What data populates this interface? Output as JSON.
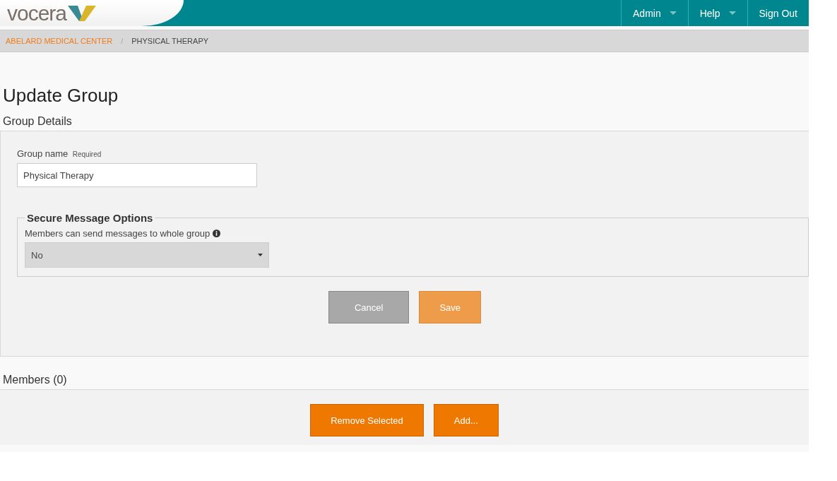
{
  "header": {
    "logo": "vocera",
    "menu": [
      {
        "label": "Admin",
        "dropdown": true
      },
      {
        "label": "Help",
        "dropdown": true
      },
      {
        "label": "Sign Out",
        "dropdown": false
      }
    ]
  },
  "breadcrumb": [
    "ABELARD MEDICAL CENTER",
    "PHYSICAL THERAPY"
  ],
  "breadcrumb_separator": "/",
  "title": "Update Group",
  "group_details": {
    "heading": "Group Details",
    "name_label": "Group name",
    "required": "Required",
    "name_value": "Physical Therapy",
    "fieldset": {
      "legend": "Secure Message Options",
      "label": "Members can send messages to whole group",
      "value": "No"
    },
    "buttons": [
      {
        "label": "Cancel",
        "kind": "secondary",
        "disabled": false
      },
      {
        "label": "Save",
        "kind": "primary",
        "disabled": true
      }
    ]
  },
  "members": {
    "heading": "Members (0)",
    "buttons": [
      {
        "label": "Remove Selected",
        "kind": "primary",
        "disabled": false
      },
      {
        "label": "Add...",
        "kind": "primary",
        "disabled": false
      }
    ]
  }
}
